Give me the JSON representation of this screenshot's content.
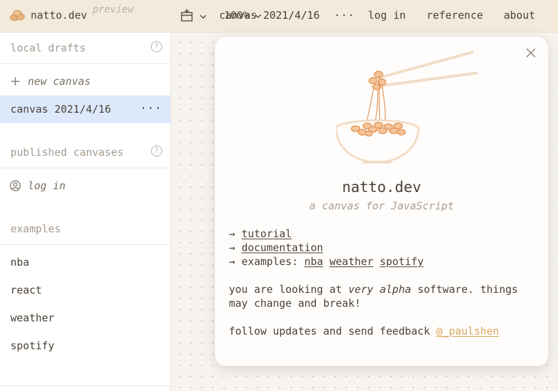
{
  "topbar": {
    "brand_name": "natto.dev",
    "brand_tag": "preview",
    "zoom": "100%",
    "canvas_name": "canvas 2021/4/16",
    "more": "···",
    "login": "log in",
    "reference": "reference",
    "about": "about"
  },
  "sidebar": {
    "local_drafts": "local drafts",
    "new_canvas": "new canvas",
    "active_canvas": "canvas 2021/4/16",
    "more": "···",
    "published": "published canvases",
    "login": "log in",
    "examples_label": "examples",
    "examples": [
      "nba",
      "react",
      "weather",
      "spotify"
    ],
    "help": "?"
  },
  "card": {
    "title": "natto.dev",
    "subtitle": "a canvas for JavaScript",
    "arrow": "→",
    "tutorial": "tutorial",
    "documentation": "documentation",
    "examples_prefix": "examples:",
    "example_links": [
      "nba",
      "weather",
      "spotify"
    ],
    "alpha_before": "you are looking at",
    "alpha_emph": "very alpha",
    "alpha_after": "software. things may change and break!",
    "follow_text": "follow updates and send feedback",
    "handle": "@_paulshen"
  },
  "colors": {
    "topbar_bg": "#f3eadb",
    "active_row": "#dde9fb",
    "link_accent": "#d9a45e",
    "illustration": "#e8a868"
  }
}
